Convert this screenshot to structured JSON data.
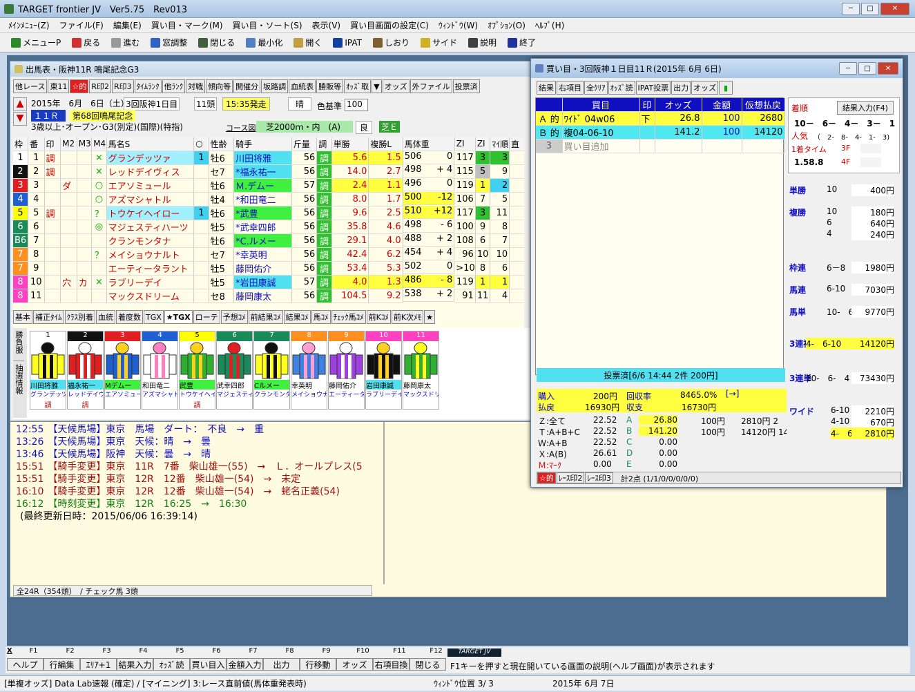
{
  "app": {
    "title": "TARGET frontier JV　Ver5.75　Rev013"
  },
  "menu": [
    "ﾒｲﾝﾒﾆｭｰ(Z)",
    "ファイル(F)",
    "編集(E)",
    "買い目・マーク(M)",
    "買い目・ソート(S)",
    "表示(V)",
    "買い目画面の設定(C)",
    "ｳｨﾝﾄﾞｳ(W)",
    "ｵﾌﾟｼｮﾝ(O)",
    "ﾍﾙﾌﾟ(H)"
  ],
  "toolbar": [
    "メニューP",
    "戻る",
    "進む",
    "窓調整",
    "閉じる",
    "最小化",
    "開く",
    "IPAT",
    "しおり",
    "サイド",
    "説明",
    "終了"
  ],
  "race_window": {
    "title": "出馬表・阪神11R 鳴尾記念G3",
    "buttons": [
      "他レース",
      "東11",
      "☆的",
      "R印2",
      "R印3",
      "ﾀｲﾑﾗﾝｸ",
      "他ﾗﾝｸ",
      "対戦",
      "傾向等",
      "開催分",
      "坂路調",
      "血統表",
      "勝販等",
      "ｵｯｽﾞ取",
      "▼",
      "オッズ",
      "外ファイル",
      "投票済"
    ],
    "date": "2015年　6月　6日（土）",
    "meeting": "3回阪神1日目",
    "heads": "11頭",
    "start": "15:35発走",
    "weather": "晴",
    "race_no": "１１Ｒ",
    "race_name": "第68回鳴尾記念",
    "condition": "3歳以上･オープン･G3(別定)(国際)(特指)",
    "course_label": "コース図",
    "course": "芝2000ｍ・内　(A)",
    "going": "良",
    "track_code": "芝Ｅ",
    "color_label": "色基準",
    "color_value": "100",
    "columns": [
      "枠",
      "番",
      "印",
      "M2",
      "M3",
      "M4",
      "馬名S",
      "○",
      "性齢",
      "騎手",
      "斤量",
      "調",
      "単勝",
      "複勝L",
      "馬体重",
      "ZI",
      "ZI",
      "ﾏｲ順",
      "直"
    ],
    "horses": [
      {
        "waku": "1",
        "no": "1",
        "mark": "調",
        "m2": "",
        "m4": "×",
        "name": "グランデッツァ",
        "ind": "1",
        "sex": "牡6",
        "jockey": "川田将雅",
        "kin": "56",
        "cho": "調",
        "win": "5.6",
        "place": "1.5",
        "weight": "506",
        "diff": "0",
        "zi": "117",
        "zi2": "3",
        "rank": "3"
      },
      {
        "waku": "2",
        "no": "2",
        "mark": "調",
        "m2": "",
        "m4": "×",
        "name": "レッドデイヴィス",
        "ind": "",
        "sex": "セ7",
        "jockey": "*福永祐一",
        "kin": "56",
        "cho": "調",
        "win": "14.0",
        "place": "2.7",
        "weight": "498",
        "diff": "+ 4",
        "zi": "115",
        "zi2": "5",
        "rank": "9"
      },
      {
        "waku": "3",
        "no": "3",
        "mark": "",
        "m2": "ダ",
        "m4": "○",
        "name": "エアソミュール",
        "ind": "",
        "sex": "牡6",
        "jockey": "Ｍ.デムー",
        "kin": "57",
        "cho": "調",
        "win": "2.4",
        "place": "1.1",
        "weight": "496",
        "diff": "0",
        "zi": "119",
        "zi2": "1",
        "rank": "2"
      },
      {
        "waku": "4",
        "no": "4",
        "mark": "",
        "m2": "",
        "m4": "○",
        "name": "アズマシャトル",
        "ind": "",
        "sex": "牡4",
        "jockey": "*和田竜二",
        "kin": "56",
        "cho": "調",
        "win": "8.0",
        "place": "1.7",
        "weight": "500",
        "diff": "-12",
        "zi": "106",
        "zi2": "7",
        "rank": "5"
      },
      {
        "waku": "5",
        "no": "5",
        "mark": "調",
        "m2": "",
        "m4": "？",
        "name": "トウケイヘイロー",
        "ind": "1",
        "sex": "牡6",
        "jockey": "*武豊",
        "kin": "56",
        "cho": "調",
        "win": "9.6",
        "place": "2.5",
        "weight": "510",
        "diff": "+12",
        "zi": "117",
        "zi2": "3",
        "rank": "11"
      },
      {
        "waku": "6",
        "no": "6",
        "mark": "",
        "m2": "",
        "m4": "◎",
        "name": "マジェスティハーツ",
        "ind": "",
        "sex": "牡5",
        "jockey": "*武幸四郎",
        "kin": "56",
        "cho": "調",
        "win": "35.8",
        "place": "4.6",
        "weight": "498",
        "diff": "- 6",
        "zi": "100",
        "zi2": "9",
        "rank": "8"
      },
      {
        "waku": "B6",
        "no": "7",
        "mark": "",
        "m2": "",
        "m4": "",
        "name": "クランモンタナ",
        "ind": "",
        "sex": "牡6",
        "jockey": "*C.ルメー",
        "kin": "56",
        "cho": "調",
        "win": "29.1",
        "place": "4.0",
        "weight": "488",
        "diff": "+ 2",
        "zi": "108",
        "zi2": "6",
        "rank": "7"
      },
      {
        "waku": "7",
        "no": "8",
        "mark": "",
        "m2": "",
        "m4": "？",
        "name": "メイショウナルト",
        "ind": "",
        "sex": "セ7",
        "jockey": "*幸英明",
        "kin": "56",
        "cho": "調",
        "win": "42.4",
        "place": "6.2",
        "weight": "454",
        "diff": "+ 4",
        "zi": "96",
        "zi2": "10",
        "rank": "10"
      },
      {
        "waku": "7",
        "no": "9",
        "mark": "",
        "m2": "",
        "m4": "",
        "name": "エーティータラント",
        "ind": "",
        "sex": "牡5",
        "jockey": "藤岡佑介",
        "kin": "56",
        "cho": "調",
        "win": "53.4",
        "place": "5.3",
        "weight": "502",
        "diff": "0",
        "zi": ">105",
        "zi2": "8",
        "rank": "6"
      },
      {
        "waku": "8",
        "no": "10",
        "mark": "",
        "m2": "穴",
        "m3": "カ",
        "m4": "×",
        "name": "ラブリーデイ",
        "ind": "",
        "sex": "牡5",
        "jockey": "*岩田康誠",
        "kin": "57",
        "cho": "調",
        "win": "4.0",
        "place": "1.3",
        "weight": "486",
        "diff": "- 8",
        "zi": "119",
        "zi2": "1",
        "rank": "1"
      },
      {
        "waku": "8",
        "no": "11",
        "mark": "",
        "m2": "",
        "m4": "",
        "name": "マックスドリーム",
        "ind": "",
        "sex": "セ8",
        "jockey": "藤岡康太",
        "kin": "56",
        "cho": "調",
        "win": "104.5",
        "place": "9.2",
        "weight": "538",
        "diff": "+ 2",
        "zi": "91",
        "zi2": "11",
        "rank": "4"
      }
    ],
    "lower_tabs": [
      "基本",
      "補正ﾀｲﾑ",
      "ｸﾗｽ別着",
      "血統",
      "着度数",
      "TGX",
      "★TGX",
      "ローテ",
      "予想ｺﾒ",
      "前結果ｺﾒ",
      "結果ｺﾒ",
      "馬ｺﾒ",
      "ﾁｪｯｸ馬ｺﾒ",
      "前Kｺﾒ",
      "前K次ﾒﾓ",
      "★"
    ],
    "side_tabs": [
      "勝負服",
      "抽選情報"
    ],
    "silks": [
      {
        "no": "1",
        "jockey": "川田将雅",
        "horse": "グランデッツァ",
        "mark": "調"
      },
      {
        "no": "2",
        "jockey": "福永祐一",
        "horse": "レッドデイヴィ",
        "mark": "調"
      },
      {
        "no": "3",
        "jockey": "Mデムー",
        "horse": "エアソミュール",
        "mark": ""
      },
      {
        "no": "4",
        "jockey": "和田竜二",
        "horse": "アズマシャトル",
        "mark": ""
      },
      {
        "no": "5",
        "jockey": "武豊",
        "horse": "トウケイヘイロ",
        "mark": "調"
      },
      {
        "no": "6",
        "jockey": "武幸四郎",
        "horse": "マジェスティハ",
        "mark": ""
      },
      {
        "no": "7",
        "jockey": "Cルメー",
        "horse": "クランモンタナ",
        "mark": ""
      },
      {
        "no": "8",
        "jockey": "幸英明",
        "horse": "メイショウナル",
        "mark": ""
      },
      {
        "no": "9",
        "jockey": "藤岡佑介",
        "horse": "エーティータラ",
        "mark": ""
      },
      {
        "no": "10",
        "jockey": "岩田康誠",
        "horse": "ラブリーデイ",
        "mark": ""
      },
      {
        "no": "11",
        "jockey": "藤岡康太",
        "horse": "マックスドリー",
        "mark": ""
      }
    ]
  },
  "log": [
    {
      "t": "12:55",
      "text": "【天候馬場】東京　馬場　ダート：　不良　→　重",
      "c": "#1010c0"
    },
    {
      "t": "13:26",
      "text": "【天候馬場】東京　天候：晴　→　曇",
      "c": "#1010c0"
    },
    {
      "t": "13:46",
      "text": "【天候馬場】阪神　天候：曇　→　晴",
      "c": "#1010c0"
    },
    {
      "t": "15:51",
      "text": "【騎手変更】東京　11R　7番　柴山雄一(55)　→　Ｌ．オールプレス(5",
      "c": "#a01010"
    },
    {
      "t": "15:51",
      "text": "【騎手変更】東京　12R　12番　柴山雄一(54)　→　未定",
      "c": "#a01010"
    },
    {
      "t": "16:10",
      "text": "【騎手変更】東京　12R　12番　柴山雄一(54)　→　蛯名正義(54)",
      "c": "#a01010"
    },
    {
      "t": "16:12",
      "text": "【時刻変更】東京　12R　16:25　→　16:30",
      "c": "#108010"
    },
    {
      "t": "",
      "text": "(最終更新日時：2015/06/06 16:39:14)",
      "c": "#000"
    }
  ],
  "log_status": "全24R（354頭）　/ チェック馬 3頭",
  "kaime": {
    "title": "買い目・3回阪神１日目11Ｒ(2015年 6月 6日)",
    "buttons": [
      "結果",
      "右項目",
      "全ｸﾘｱ",
      "ｵｯｽﾞ読",
      "IPAT投票",
      "出力",
      "オッズ"
    ],
    "columns": [
      "",
      "買目",
      "印",
      "オッズ",
      "金額",
      "仮想払戻"
    ],
    "rows": [
      {
        "label": "Ａ 的",
        "bet": "ﾜｲﾄﾞ 04w06",
        "mark": "下",
        "odds": "26.8",
        "amount": "100",
        "payout": "2680"
      },
      {
        "label": "Ｂ 的",
        "bet": "複04-06-10",
        "mark": "",
        "odds": "141.2",
        "amount": "100",
        "payout": "14120"
      },
      {
        "label": "3",
        "bet": "買い目追加",
        "mark": "",
        "odds": "",
        "amount": "",
        "payout": ""
      }
    ],
    "voted": "投票済[6/6 14:44 2件 200円]",
    "buy_label": "購入",
    "buy": "200円",
    "ret_rate_label": "回収率",
    "ret_rate": "8465.0%",
    "arrow": "[→]",
    "pay_label": "払戻",
    "pay": "16930円",
    "profit_label": "収支",
    "profit": "16730円",
    "summary": [
      {
        "k": "Ｚ:全て",
        "v": "22.52",
        "g": "A",
        "o": "26.80",
        "a": "100円",
        "p": "2810円 2"
      },
      {
        "k": "Ｔ:A+B+C",
        "v": "22.52",
        "g": "B",
        "o": "141.20",
        "a": "100円",
        "p": "14120円 14"
      },
      {
        "k": "Ｗ:A+B",
        "v": "22.52",
        "g": "C",
        "o": "0.00",
        "a": "",
        "p": ""
      },
      {
        "k": "Ｘ:A(B)",
        "v": "26.61",
        "g": "D",
        "o": "0.00",
        "a": "",
        "p": ""
      },
      {
        "k": "Ｍ:ﾏｰｸ",
        "v": "0.00",
        "g": "E",
        "o": "0.00",
        "a": "",
        "p": ""
      }
    ],
    "status_tabs": [
      "☆的",
      "ﾚｰｽ印2",
      "ﾚｰｽ印3"
    ],
    "status_text": "計2点 (1/1/0/0/0/0/0)"
  },
  "result": {
    "order_label": "着順",
    "order": "10－　6－　4－　3－　1",
    "input_btn": "結果入力(F4)",
    "pop_label": "人気",
    "pop": "（　2-　8-　4-　1-　3)",
    "time_label": "1着タイム",
    "time": "1.58.8",
    "f3": "3F",
    "f4": "4F",
    "payouts": [
      {
        "k": "単勝",
        "n": "10",
        "y": "400円"
      },
      {
        "k": "複勝",
        "n": "10",
        "y": "180円"
      },
      {
        "k": "",
        "n": "6",
        "y": "640円"
      },
      {
        "k": "",
        "n": "4",
        "y": "240円"
      },
      {
        "k": "枠連",
        "n": "6－8",
        "y": "1980円"
      },
      {
        "k": "馬連",
        "n": "6-10",
        "y": "7030円"
      },
      {
        "k": "馬単",
        "n": "10-　6",
        "y": "9770円"
      },
      {
        "k": "3連複",
        "n": "4-　6-10",
        "y": "14120円"
      },
      {
        "k": "3連単",
        "n": "10-　6-　4",
        "y": "73430円"
      },
      {
        "k": "ワイド",
        "n": "6-10",
        "y": "2210円"
      },
      {
        "k": "",
        "n": "4-10",
        "y": "670円"
      },
      {
        "k": "",
        "n": "4-　6",
        "y": "2810円"
      }
    ]
  },
  "fkeys": {
    "labels": [
      "F1",
      "F2",
      "F3",
      "F4",
      "F5",
      "F6",
      "F7",
      "F8",
      "F9",
      "F10",
      "F11",
      "F12"
    ],
    "buttons": [
      "ヘルプ",
      "行編集",
      "ｴﾘｱ+1",
      "結果入力",
      "ｵｯｽﾞ読",
      "買い目入",
      "金額入力",
      "出力",
      "行移動",
      "オッズ",
      "右項目換",
      "閉じる"
    ],
    "logo": "TARGET JV",
    "help": "F1キーを押すと現在開いている画面の説明(ヘルプ画面)が表示されます",
    "x": "X"
  },
  "status": {
    "s1": "[単複オッズ]  Data Lab速報 (確定) / [マイニング] 3:レース直前値(馬体重発表時)",
    "s2": "ｳｨﾝﾄﾞｳ位置 3/ 3",
    "s3": "2015年 6月 7日"
  }
}
